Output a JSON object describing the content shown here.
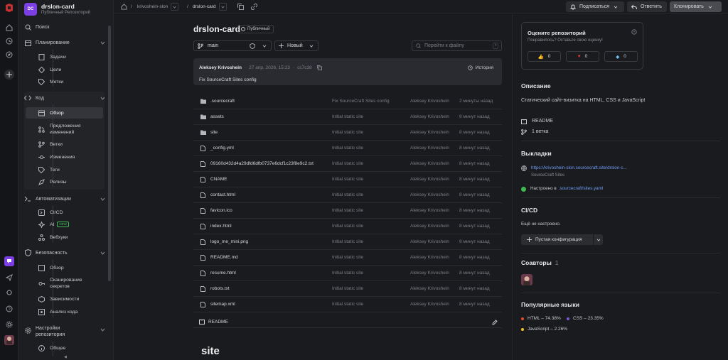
{
  "repo": {
    "avatar": "DC",
    "name": "drslon-card",
    "subtitle": "Публичный Репозиторий",
    "visibility": "Публичный"
  },
  "breadcrumb": {
    "owner": "krivoshein-slon",
    "repo": "drslon-card"
  },
  "topbar": {
    "subscribe": "Подписаться",
    "reply": "Ответить",
    "clone": "Клонировать"
  },
  "sidebar": {
    "search": "Поиск",
    "planning": "Планирование",
    "planning_items": [
      "Задачи",
      "Цели",
      "Метки"
    ],
    "code": "Код",
    "code_items": [
      "Обзор",
      "Предложения изменений",
      "Ветки",
      "Изменения",
      "Теги",
      "Релизы"
    ],
    "automation": "Автоматизации",
    "automation_items": [
      "CI/CD",
      "AI",
      "Вебхуки"
    ],
    "ai_badge": "NEW",
    "security": "Безопасность",
    "security_items": [
      "Обзор",
      "Сканирование секретов",
      "Зависимости",
      "Анализ кода"
    ],
    "settings": "Настройки репозитория",
    "settings_items": [
      "Общее"
    ]
  },
  "toolbar": {
    "branch": "main",
    "new_label": "Новый",
    "goto_placeholder": "Перейти к файлу",
    "goto_key": "t"
  },
  "commit": {
    "author": "Aleksey Krivoshein",
    "date": "27 апр. 2026, 15:23",
    "hash": "cc7c38",
    "history": "История",
    "message": "Fix SourceCraft Sites config"
  },
  "files": [
    {
      "name": ".sourcecraft",
      "type": "folder",
      "message": "Fix SourceCraft Sites config",
      "author": "Aleksey Krivoshein",
      "time": "2 минуты назад"
    },
    {
      "name": "assets",
      "type": "folder",
      "message": "Initial static site",
      "author": "Aleksey Krivoshein",
      "time": "8 минут назад"
    },
    {
      "name": "site",
      "type": "folder",
      "message": "Initial static site",
      "author": "Aleksey Krivoshein",
      "time": "8 минут назад"
    },
    {
      "name": "_config.yml",
      "type": "file",
      "message": "Initial static site",
      "author": "Aleksey Krivoshein",
      "time": "8 минут назад"
    },
    {
      "name": "09160d432d4a29dfd6dfb0737e6dcf1c23f8e9c2.txt",
      "type": "file",
      "message": "Initial static site",
      "author": "Aleksey Krivoshein",
      "time": "8 минут назад"
    },
    {
      "name": "CNAME",
      "type": "file",
      "message": "Initial static site",
      "author": "Aleksey Krivoshein",
      "time": "8 минут назад"
    },
    {
      "name": "contact.html",
      "type": "file",
      "message": "Initial static site",
      "author": "Aleksey Krivoshein",
      "time": "8 минут назад"
    },
    {
      "name": "favicon.ico",
      "type": "file",
      "message": "Initial static site",
      "author": "Aleksey Krivoshein",
      "time": "8 минут назад"
    },
    {
      "name": "index.html",
      "type": "file",
      "message": "Initial static site",
      "author": "Aleksey Krivoshein",
      "time": "8 минут назад"
    },
    {
      "name": "logo_me_mini.png",
      "type": "file",
      "message": "Initial static site",
      "author": "Aleksey Krivoshein",
      "time": "8 минут назад"
    },
    {
      "name": "README.md",
      "type": "file",
      "message": "Initial static site",
      "author": "Aleksey Krivoshein",
      "time": "8 минут назад"
    },
    {
      "name": "resume.html",
      "type": "file",
      "message": "Initial static site",
      "author": "Aleksey Krivoshein",
      "time": "8 минут назад"
    },
    {
      "name": "robots.txt",
      "type": "file",
      "message": "Initial static site",
      "author": "Aleksey Krivoshein",
      "time": "8 минут назад"
    },
    {
      "name": "sitemap.xml",
      "type": "file",
      "message": "Initial static site",
      "author": "Aleksey Krivoshein",
      "time": "8 минут назад"
    }
  ],
  "readme": {
    "tab": "README",
    "heading": "site"
  },
  "rating": {
    "title": "Оцените репозиторий",
    "subtitle": "Понравилось? Оставьте свою оценку!",
    "like": "0",
    "heart": "0",
    "gem": "0"
  },
  "about": {
    "title": "Описание",
    "description": "Статический сайт-визитка на HTML, CSS и JavaScript",
    "readme": "README",
    "branches": "1 ветка"
  },
  "deployments": {
    "title": "Выкладки",
    "url": "https://krivoshein-slon.sourcecraft.site/drslon-c...",
    "source": "SourceCraft Sites",
    "configured_prefix": "Настроено в",
    "configured_link": ".sourcecraft/sites.yaml"
  },
  "cicd": {
    "title": "CI/CD",
    "status": "Ещё не настроено.",
    "button": "Пустая конфигурация"
  },
  "contributors": {
    "title": "Соавторы",
    "count": "1"
  },
  "languages": {
    "title": "Популярные языки",
    "items": [
      {
        "label": "HTML – 74.38%",
        "color": "#e34c26"
      },
      {
        "label": "CSS – 23.35%",
        "color": "#7b5cd6"
      },
      {
        "label": "JavaScript – 2.26%",
        "color": "#f1c40f"
      }
    ]
  }
}
